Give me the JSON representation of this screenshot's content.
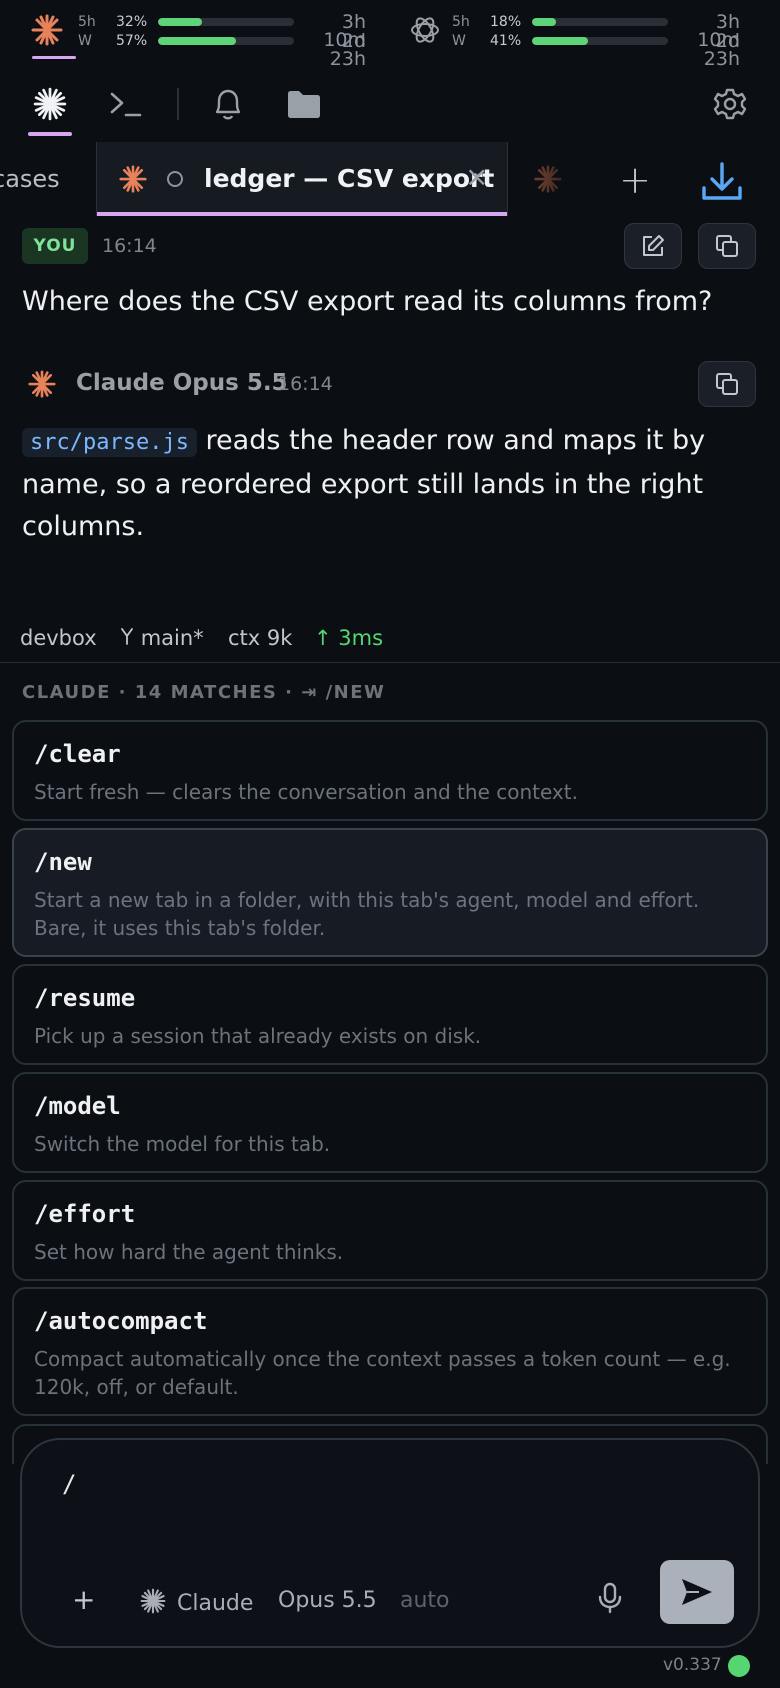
{
  "usage": {
    "claude": {
      "icon": "claude-asterisk-icon",
      "rows": [
        {
          "label": "5h",
          "pct_text": "32%",
          "pct": 0.32,
          "time": "3h 10m"
        },
        {
          "label": "W",
          "pct_text": "57%",
          "pct": 0.57,
          "time": "2d 23h"
        }
      ]
    },
    "openai": {
      "icon": "openai-knot-icon",
      "rows": [
        {
          "label": "5h",
          "pct_text": "18%",
          "pct": 0.18,
          "time": "3h 10m"
        },
        {
          "label": "W",
          "pct_text": "41%",
          "pct": 0.41,
          "time": "2d 23h"
        }
      ]
    },
    "bar_color": "#5ed37a"
  },
  "toolbar": {
    "icons": [
      "claude-asterisk-icon",
      "terminal-icon",
      "bell-icon",
      "folder-icon",
      "gear-icon"
    ]
  },
  "tabs": {
    "left_partial": "cases",
    "active": {
      "title": "ledger — CSV export",
      "close": "×"
    },
    "add": "+",
    "accent": "#d6a6f0"
  },
  "messages": {
    "user": {
      "badge": "YOU",
      "time": "16:14",
      "text": "Where does the CSV export read its columns from?"
    },
    "assistant": {
      "name": "Claude Opus 5.5",
      "time": "16:14",
      "code": "src/parse.js",
      "line1": "reads the header row and maps it by",
      "line2": "name, so a reordered export still lands in the right",
      "line3": "columns."
    }
  },
  "status": {
    "host": "devbox",
    "branch": "main*",
    "ctx": "ctx 9k",
    "latency": "↑ 3ms",
    "latency_color": "#56d672"
  },
  "palette": {
    "header": "CLAUDE · 14 MATCHES · ⇥ /NEW",
    "commands": [
      {
        "name": "/clear",
        "desc": "Start fresh — clears the conversation and the context."
      },
      {
        "name": "/new",
        "desc": "Start a new tab in a folder, with this tab's agent, model and effort. Bare, it uses this tab's folder."
      },
      {
        "name": "/resume",
        "desc": "Pick up a session that already exists on disk."
      },
      {
        "name": "/model",
        "desc": "Switch the model for this tab."
      },
      {
        "name": "/effort",
        "desc": "Set how hard the agent thinks."
      },
      {
        "name": "/autocompact",
        "desc": "Compact automatically once the context passes a token count — e.g. 120k, off, or default."
      }
    ]
  },
  "composer": {
    "value": "/",
    "add": "+",
    "agent": "Claude",
    "model": "Opus 5.5",
    "effort": "auto"
  },
  "footer": {
    "version": "v0.337",
    "status_color": "#56d672"
  }
}
